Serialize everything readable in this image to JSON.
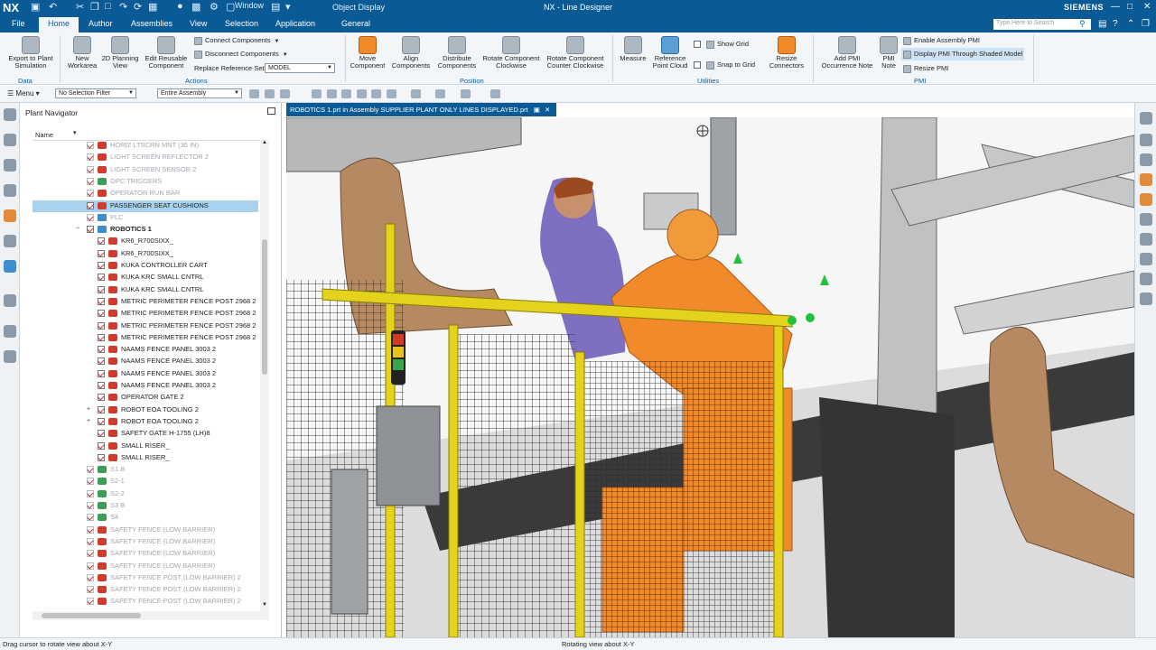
{
  "app": {
    "logo": "NX",
    "title": "NX - Line Designer",
    "brand": "SIEMENS",
    "context_tab": "Object Display",
    "window_menu": "Window",
    "window_controls": [
      "—",
      "□",
      "✕"
    ]
  },
  "menubar": {
    "tabs": [
      {
        "label": "File",
        "active": false
      },
      {
        "label": "Home",
        "active": true
      },
      {
        "label": "Author",
        "active": false
      },
      {
        "label": "Assemblies",
        "active": false
      },
      {
        "label": "View",
        "active": false
      },
      {
        "label": "Selection",
        "active": false
      },
      {
        "label": "Application",
        "active": false
      },
      {
        "label": "General",
        "active": false
      }
    ],
    "search_placeholder": "Type Here to Search"
  },
  "ribbon": {
    "buttons": [
      {
        "label": "Export to Plant Simulation",
        "icon": "export-simulation-icon"
      },
      {
        "label": "New Workarea",
        "icon": "workarea-icon"
      },
      {
        "label": "2D Planning View",
        "icon": "planning-view-icon"
      },
      {
        "label": "Edit Reusable Component",
        "icon": "edit-component-icon"
      },
      {
        "label": "Move Component",
        "icon": "move-component-icon"
      },
      {
        "label": "Align Components",
        "icon": "align-components-icon"
      },
      {
        "label": "Distribute Components",
        "icon": "distribute-components-icon"
      },
      {
        "label": "Rotate Component Clockwise",
        "icon": "rotate-clockwise-icon"
      },
      {
        "label": "Rotate Component Counter Clockwise",
        "icon": "rotate-counterclockwise-icon"
      },
      {
        "label": "Measure",
        "icon": "measure-icon"
      },
      {
        "label": "Reference Point Cloud",
        "icon": "point-cloud-icon"
      },
      {
        "label": "Resize Connectors",
        "icon": "resize-connectors-icon"
      },
      {
        "label": "Add PMI Occurrence Note",
        "icon": "pmi-note-icon"
      },
      {
        "label": "PMI Note",
        "icon": "pmi-note-small-icon"
      }
    ],
    "small": {
      "connect": "Connect Components",
      "disconnect": "Disconnect Components",
      "replace_label": "Replace Reference Set",
      "replace_value": "MODEL",
      "show_grid": "Show Grid",
      "snap_grid": "Snap to Grid",
      "enable_pmi": "Enable Assembly PMI",
      "display_pmi": "Display PMI Through Shaded Model",
      "resize_pmi": "Resize PMI"
    },
    "groups": {
      "data": "Data",
      "actions": "Actions",
      "position": "Position",
      "utilities": "Utilities",
      "pmi": "PMI"
    }
  },
  "selbar": {
    "menu": "Menu",
    "filter": "No Selection Filter",
    "scope": "Entire Assembly"
  },
  "navigator": {
    "title": "Plant Navigator",
    "column": "Name",
    "rows": [
      {
        "label": "HORIZ LTSCRN MNT (36 IN)",
        "indent": 0,
        "gray": true,
        "icon": "part"
      },
      {
        "label": "LIGHT SCREEN REFLECTOR 2",
        "indent": 0,
        "gray": true,
        "icon": "part"
      },
      {
        "label": "LIGHT SCREEN SENSOR 2",
        "indent": 0,
        "gray": true,
        "icon": "part"
      },
      {
        "label": "OPC TRIGGERS",
        "indent": 0,
        "gray": true,
        "icon": "ok"
      },
      {
        "label": "OPERATOR RUN BAR",
        "indent": 0,
        "gray": true,
        "icon": "part"
      },
      {
        "label": "PASSENGER SEAT CUSHIONS",
        "indent": 0,
        "selected": true,
        "icon": "part"
      },
      {
        "label": "PLC",
        "indent": 0,
        "gray": true,
        "icon": "inst"
      },
      {
        "label": "ROBOTICS 1",
        "indent": 0,
        "bold": true,
        "expanded": true,
        "icon": "inst"
      },
      {
        "label": "KR6_R700SIXX_",
        "indent": 1,
        "icon": "part"
      },
      {
        "label": "KR6_R700SIXX_",
        "indent": 1,
        "icon": "part"
      },
      {
        "label": "KUKA CONTROLLER CART",
        "indent": 1,
        "icon": "part"
      },
      {
        "label": "KUKA KRC SMALL CNTRL",
        "indent": 1,
        "icon": "part"
      },
      {
        "label": "KUKA KRC SMALL CNTRL",
        "indent": 1,
        "icon": "part"
      },
      {
        "label": "METRIC PERIMETER FENCE POST 2968 2",
        "indent": 1,
        "icon": "part"
      },
      {
        "label": "METRIC PERIMETER FENCE POST 2968 2",
        "indent": 1,
        "icon": "part"
      },
      {
        "label": "METRIC PERIMETER FENCE POST 2968 2",
        "indent": 1,
        "icon": "part"
      },
      {
        "label": "METRIC PERIMETER FENCE POST 2968 2",
        "indent": 1,
        "icon": "part"
      },
      {
        "label": "NAAMS FENCE PANEL 3003 2",
        "indent": 1,
        "icon": "part"
      },
      {
        "label": "NAAMS FENCE PANEL 3003 2",
        "indent": 1,
        "icon": "part"
      },
      {
        "label": "NAAMS FENCE PANEL 3003 2",
        "indent": 1,
        "icon": "part"
      },
      {
        "label": "NAAMS FENCE PANEL 3003 2",
        "indent": 1,
        "icon": "part"
      },
      {
        "label": "OPERATOR GATE 2",
        "indent": 1,
        "icon": "part"
      },
      {
        "label": "ROBOT EOA TOOLING 2",
        "indent": 1,
        "collapsed": true,
        "icon": "part"
      },
      {
        "label": "ROBOT EOA TOOLING 2",
        "indent": 1,
        "collapsed": true,
        "icon": "part"
      },
      {
        "label": "SAFETY GATE H-1755 (LH)8",
        "indent": 1,
        "icon": "part"
      },
      {
        "label": "SMALL RISER_",
        "indent": 1,
        "icon": "part"
      },
      {
        "label": "SMALL RISER_",
        "indent": 1,
        "icon": "part"
      },
      {
        "label": "S1 B",
        "indent": 0,
        "gray": true,
        "icon": "ok"
      },
      {
        "label": "S2-1",
        "indent": 0,
        "gray": true,
        "icon": "ok"
      },
      {
        "label": "S2-2",
        "indent": 0,
        "gray": true,
        "icon": "ok"
      },
      {
        "label": "S3 B",
        "indent": 0,
        "gray": true,
        "icon": "ok"
      },
      {
        "label": "S4",
        "indent": 0,
        "gray": true,
        "icon": "ok"
      },
      {
        "label": "SAFETY FENCE (LOW BARRIER)",
        "indent": 0,
        "gray": true,
        "icon": "part"
      },
      {
        "label": "SAFETY FENCE (LOW BARRIER)",
        "indent": 0,
        "gray": true,
        "icon": "part"
      },
      {
        "label": "SAFETY FENCE (LOW BARRIER)",
        "indent": 0,
        "gray": true,
        "icon": "part"
      },
      {
        "label": "SAFETY FENCE (LOW BARRIER)",
        "indent": 0,
        "gray": true,
        "icon": "part"
      },
      {
        "label": "SAFETY FENCE POST (LOW BARRIER) 2",
        "indent": 0,
        "gray": true,
        "icon": "part"
      },
      {
        "label": "SAFETY FENCE POST (LOW BARRIER) 2",
        "indent": 0,
        "gray": true,
        "icon": "part"
      },
      {
        "label": "SAFETY FENCE POST (LOW BARRIER) 2",
        "indent": 0,
        "gray": true,
        "icon": "part"
      }
    ]
  },
  "graphics": {
    "tab_label": "ROBOTICS 1.prt in Assembly SUPPLIER PLANT ONLY LINES DISPLAYED.prt"
  },
  "status": {
    "left": "Drag cursor to rotate view about X-Y",
    "center": "Rotating view about X-Y"
  }
}
